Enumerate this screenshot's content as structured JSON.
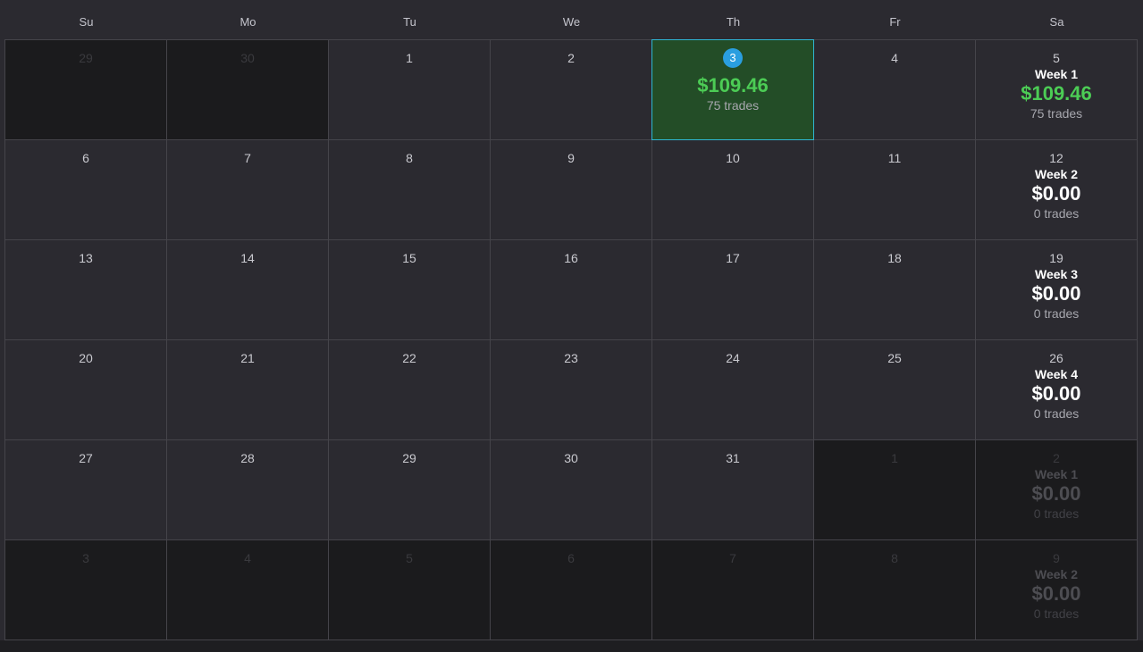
{
  "weekdays": [
    "Su",
    "Mo",
    "Tu",
    "We",
    "Th",
    "Fr",
    "Sa"
  ],
  "weeks": [
    {
      "days": [
        {
          "day": "29",
          "out": true
        },
        {
          "day": "30",
          "out": true
        },
        {
          "day": "1"
        },
        {
          "day": "2"
        },
        {
          "day": "3",
          "today": true,
          "amount": "$109.46",
          "trades": "75 trades",
          "positive": true
        },
        {
          "day": "4"
        },
        {
          "day": "5",
          "week_label": "Week 1",
          "amount": "$109.46",
          "trades": "75 trades",
          "positive": true
        }
      ]
    },
    {
      "days": [
        {
          "day": "6"
        },
        {
          "day": "7"
        },
        {
          "day": "8"
        },
        {
          "day": "9"
        },
        {
          "day": "10"
        },
        {
          "day": "11"
        },
        {
          "day": "12",
          "week_label": "Week 2",
          "amount": "$0.00",
          "trades": "0 trades"
        }
      ]
    },
    {
      "days": [
        {
          "day": "13"
        },
        {
          "day": "14"
        },
        {
          "day": "15"
        },
        {
          "day": "16"
        },
        {
          "day": "17"
        },
        {
          "day": "18"
        },
        {
          "day": "19",
          "week_label": "Week 3",
          "amount": "$0.00",
          "trades": "0 trades"
        }
      ]
    },
    {
      "days": [
        {
          "day": "20"
        },
        {
          "day": "21"
        },
        {
          "day": "22"
        },
        {
          "day": "23"
        },
        {
          "day": "24"
        },
        {
          "day": "25"
        },
        {
          "day": "26",
          "week_label": "Week 4",
          "amount": "$0.00",
          "trades": "0 trades"
        }
      ]
    },
    {
      "days": [
        {
          "day": "27"
        },
        {
          "day": "28"
        },
        {
          "day": "29"
        },
        {
          "day": "30"
        },
        {
          "day": "31"
        },
        {
          "day": "1",
          "out": true
        },
        {
          "day": "2",
          "out": true,
          "week_label": "Week 1",
          "amount": "$0.00",
          "trades": "0 trades"
        }
      ]
    },
    {
      "days": [
        {
          "day": "3",
          "out": true
        },
        {
          "day": "4",
          "out": true
        },
        {
          "day": "5",
          "out": true
        },
        {
          "day": "6",
          "out": true
        },
        {
          "day": "7",
          "out": true
        },
        {
          "day": "8",
          "out": true
        },
        {
          "day": "9",
          "out": true,
          "week_label": "Week 2",
          "amount": "$0.00",
          "trades": "0 trades"
        }
      ]
    }
  ],
  "colors": {
    "positive": "#4ccc55",
    "today_badge": "#2a9ee0",
    "active_bg": "#234d27",
    "active_border": "#2fb6d3"
  }
}
